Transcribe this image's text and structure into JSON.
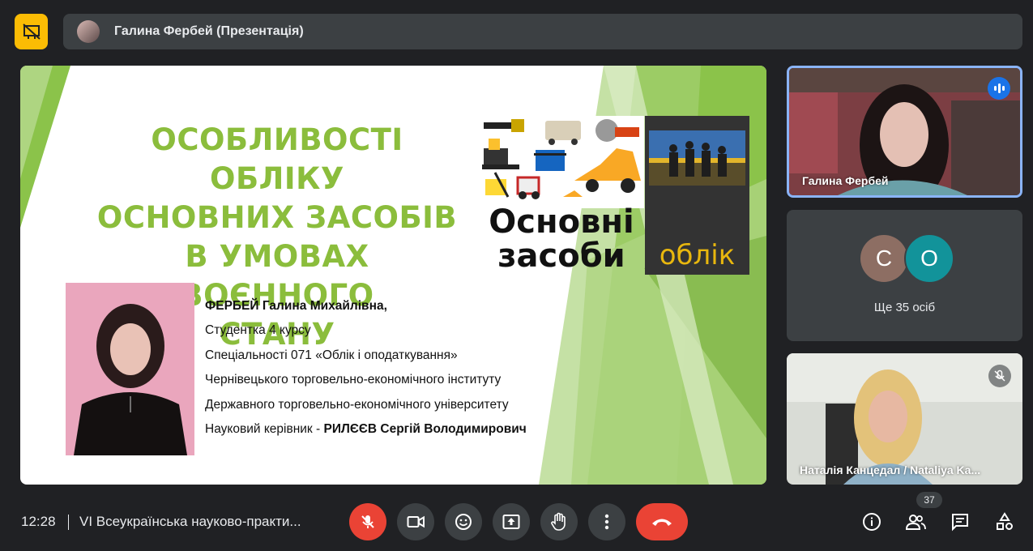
{
  "header": {
    "presenter_label": "Галина Фербей (Презентація)",
    "icons": {
      "app": "presentation-off-icon"
    }
  },
  "slide": {
    "title_lines": [
      "ОСОБЛИВОСТІ ОБЛІКУ",
      "ОСНОВНИХ ЗАСОБІВ",
      "В УМОВАХ ВОЄННОГО",
      "СТАНУ"
    ],
    "tools_caption_lines": [
      "Основні",
      "засоби"
    ],
    "side_word": "облік",
    "author_name": "ФЕРБЕЙ Галина Михайлівна,",
    "line_course": "Студентка 4 курсу",
    "line_specialty": "Спеціальності 071 «Облік і оподаткування»",
    "line_institute": "Чернівецького торговельно-економічного інституту",
    "line_university": "Державного торговельно-економічного університету",
    "advisor_prefix": "Науковий керівник -",
    "advisor_name": " РИЛЄЄВ Сергій Володимирович",
    "colors": {
      "title": "#8bbd3c",
      "accent_yellow": "#e8b70e"
    }
  },
  "participants": {
    "speaker_name": "Галина Фербей",
    "group_initials": [
      "С",
      "О"
    ],
    "more_label": "Ще 35 осіб",
    "third_name": "Наталія Канцедал / Nataliya Ka..."
  },
  "bottom": {
    "time": "12:28",
    "meeting_title": "VI Всеукраїнська науково-практи...",
    "people_count": "37",
    "colors": {
      "mic_off": "#ea4335",
      "end_call": "#ea4335",
      "bar": "#3c4043"
    }
  }
}
